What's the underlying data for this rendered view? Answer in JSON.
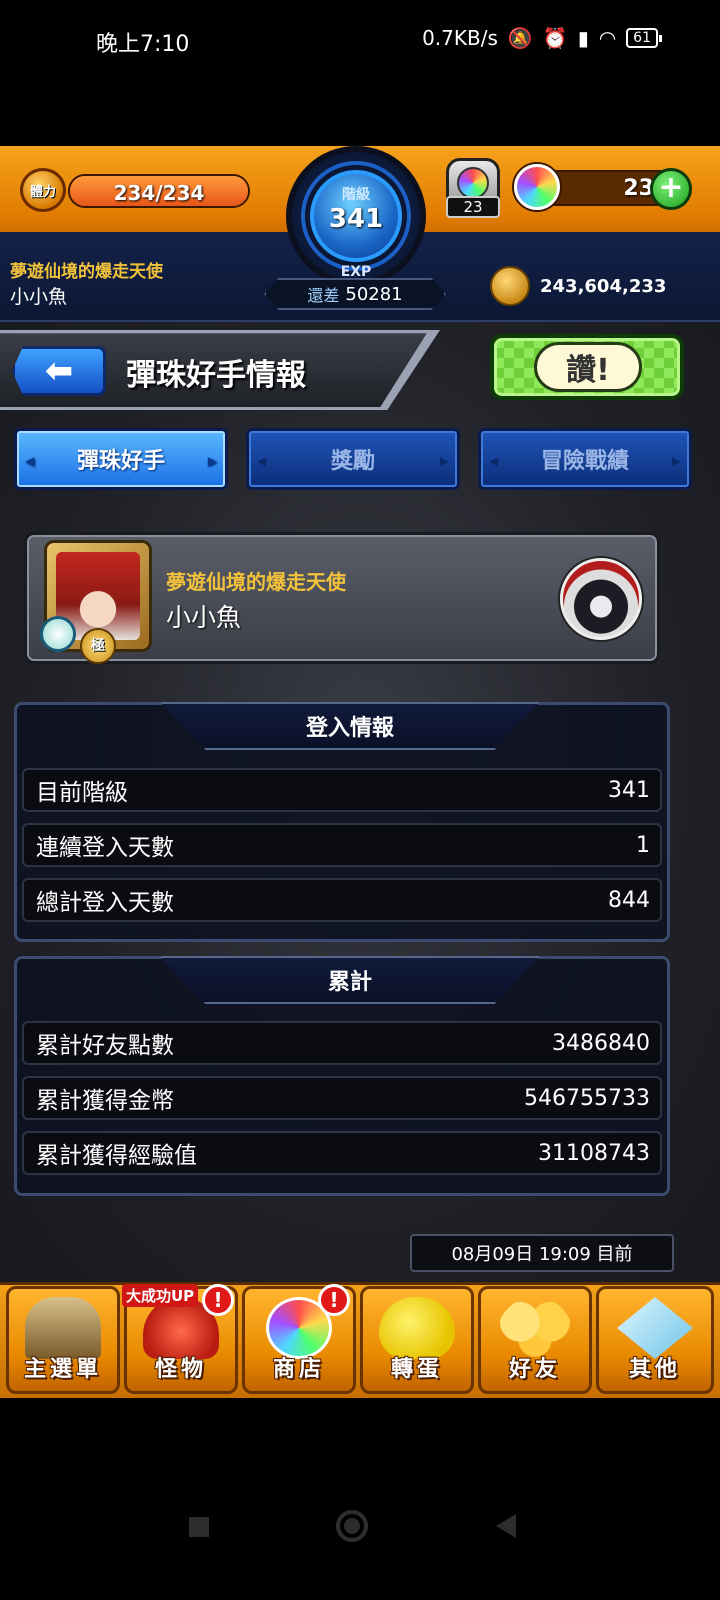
{
  "status_bar": {
    "time": "晚上7:10",
    "network_speed": "0.7KB/s",
    "battery": "61"
  },
  "header": {
    "stamina_label": "體力",
    "stamina": "234/234",
    "stamina_fill": 1.0,
    "rank_label": "階級",
    "rank": "341",
    "exp_label": "EXP",
    "exp_remaining_prefix": "還差",
    "exp_remaining": "50281",
    "gacha_count": "23",
    "orb_count": "23",
    "player_title": "夢遊仙境的爆走天使",
    "player_name": "小小魚",
    "coins": "243,604,233"
  },
  "page": {
    "title": "彈珠好手情報",
    "like_label": "讚!"
  },
  "tabs": [
    {
      "label": "彈珠好手",
      "active": true
    },
    {
      "label": "獎勵",
      "active": false
    },
    {
      "label": "冒險戰績",
      "active": false
    }
  ],
  "player_card": {
    "title": "夢遊仙境的爆走天使",
    "name": "小小魚",
    "badge": "極"
  },
  "login_info": {
    "header": "登入情報",
    "rows": [
      {
        "label": "目前階級",
        "value": "341"
      },
      {
        "label": "連續登入天數",
        "value": "1"
      },
      {
        "label": "總計登入天數",
        "value": "844"
      }
    ]
  },
  "totals": {
    "header": "累計",
    "rows": [
      {
        "label": "累計好友點數",
        "value": "3486840"
      },
      {
        "label": "累計獲得金幣",
        "value": "546755733"
      },
      {
        "label": "累計獲得經驗值",
        "value": "31108743"
      }
    ]
  },
  "timestamp": "08月09日 19:09 目前",
  "bottom_nav": {
    "promo": "大成功UP",
    "items": [
      {
        "label": "主選單",
        "icon": "gate-icon"
      },
      {
        "label": "怪物",
        "icon": "monster-icon",
        "alert": "!"
      },
      {
        "label": "商店",
        "icon": "orb-icon",
        "alert": "!"
      },
      {
        "label": "轉蛋",
        "icon": "egg-icon"
      },
      {
        "label": "好友",
        "icon": "balloons-icon"
      },
      {
        "label": "其他",
        "icon": "question-icon"
      }
    ]
  },
  "colors": {
    "header_orange": "#f7a21b",
    "tab_active": "#1a6fe6",
    "title_gold": "#f2c23a",
    "like_green": "#6fd03a"
  }
}
